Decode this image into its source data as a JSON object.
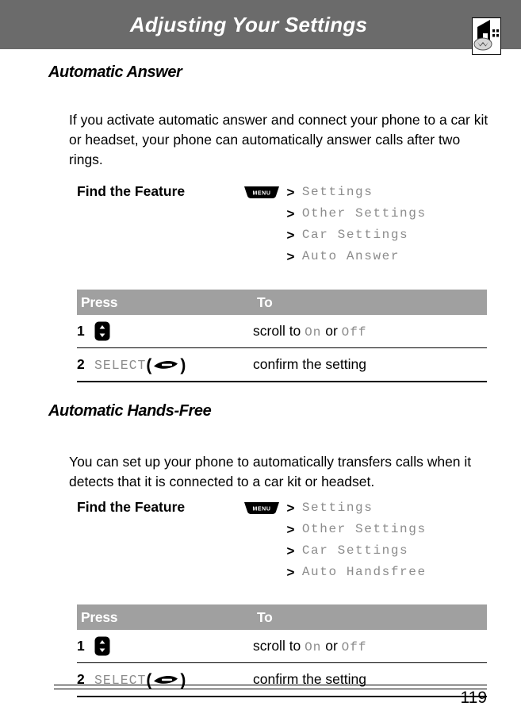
{
  "header": {
    "title": "Adjusting Your Settings",
    "icon": "motorola-phone-tower-icon",
    "background_color": "#6b6b6b",
    "title_color": "#ffffff"
  },
  "sections": [
    {
      "heading": "Automatic Answer",
      "paragraph": "If you activate automatic answer and connect your phone to a car kit or headset, your phone can automatically answer calls after two rings.",
      "find_the_feature": {
        "label": "Find the Feature",
        "menu_key": "MENU",
        "separator": ">",
        "path": [
          "Settings",
          "Other Settings",
          "Car Settings",
          "Auto Answer"
        ]
      },
      "table": {
        "columns": [
          "Press",
          "To"
        ],
        "rows": [
          {
            "num": "1",
            "key_icon": "scroll-key-icon",
            "key_label": "",
            "desc_prefix": "scroll to ",
            "desc_value_1": "On",
            "desc_middle": " or ",
            "desc_value_2": "Off"
          },
          {
            "num": "2",
            "key_icon": "softkey-arrow-icon",
            "key_label": "SELECT",
            "paren_open": "(",
            "paren_close": ")",
            "desc_prefix": "confirm the setting",
            "desc_value_1": "",
            "desc_middle": "",
            "desc_value_2": ""
          }
        ]
      }
    },
    {
      "heading": "Automatic Hands-Free",
      "paragraph": "You can set up your phone to automatically transfers calls when it detects that it is connected to a car kit or headset.",
      "find_the_feature": {
        "label": "Find the Feature",
        "menu_key": "MENU",
        "separator": ">",
        "path": [
          "Settings",
          "Other Settings",
          "Car Settings",
          "Auto Handsfree"
        ]
      },
      "table": {
        "columns": [
          "Press",
          "To"
        ],
        "rows": [
          {
            "num": "1",
            "key_icon": "scroll-key-icon",
            "key_label": "",
            "desc_prefix": "scroll to ",
            "desc_value_1": "On",
            "desc_middle": " or ",
            "desc_value_2": "Off"
          },
          {
            "num": "2",
            "key_icon": "softkey-arrow-icon",
            "key_label": "SELECT",
            "paren_open": "(",
            "paren_close": ")",
            "desc_prefix": "confirm the setting",
            "desc_value_1": "",
            "desc_middle": "",
            "desc_value_2": ""
          }
        ]
      }
    }
  ],
  "footer": {
    "page_number": "119"
  },
  "colors": {
    "header_gray": "#6b6b6b",
    "table_header_gray": "#a0a0a0",
    "mono_gray": "#8c8c8c"
  }
}
